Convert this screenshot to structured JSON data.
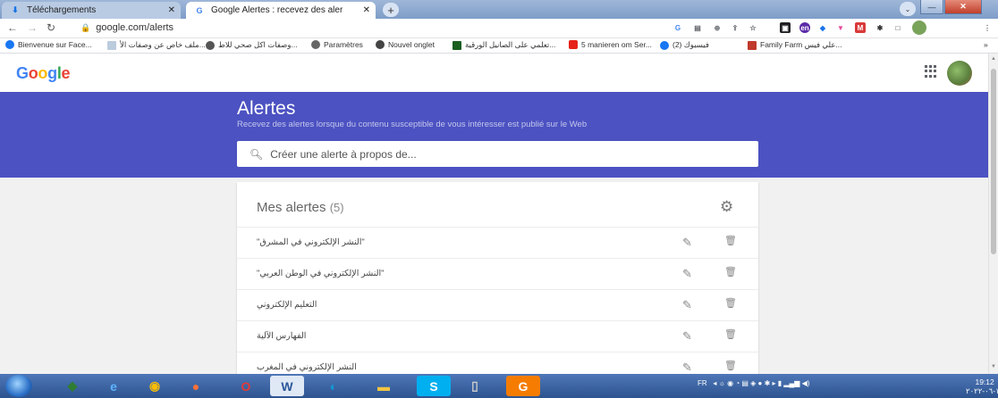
{
  "browser": {
    "tabs": [
      {
        "title": "Téléchargements",
        "active": false
      },
      {
        "title": "Google Alertes : recevez des aler",
        "active": true
      }
    ],
    "new_tab_symbol": "+",
    "url": "google.com/alerts",
    "bookmarks": [
      "Bienvenue sur Face...",
      "ملف خاص عن وصفات الأ...",
      "وصفات اكل صحي للاط...",
      "Paramètres",
      "Nouvel onglet",
      "تعلمي على الصانيل الورقية...",
      "5 manieren om Ser...",
      "(2) فيسبوك",
      "Family Farm علي فيس..."
    ],
    "bookmarks_overflow": "»"
  },
  "header": {
    "logo": "Google"
  },
  "banner": {
    "title": "Alertes",
    "subtitle": "Recevez des alertes lorsque du contenu susceptible de vous intéresser est publié sur le Web",
    "search_placeholder": "Créer une alerte à propos de..."
  },
  "alerts_card": {
    "heading": "Mes alertes",
    "count": "(5)",
    "items": [
      "\"النشر الإلكتروني في المشرق\"",
      "\"النشر الإلكتروني في الوطن العربي\"",
      "التعليم الإلكتروني",
      "الفهارس الآلية",
      "النشر الإلكتروني في المغرب"
    ]
  },
  "taskbar": {
    "language": "FR",
    "time": "19:12",
    "date": "۲۰۲۲-۰٦-۱۱"
  },
  "colors": {
    "banner": "#4c52c1",
    "google_blue": "#4285f4",
    "google_red": "#ea4335",
    "google_yellow": "#fbbc05",
    "google_green": "#34a853"
  }
}
